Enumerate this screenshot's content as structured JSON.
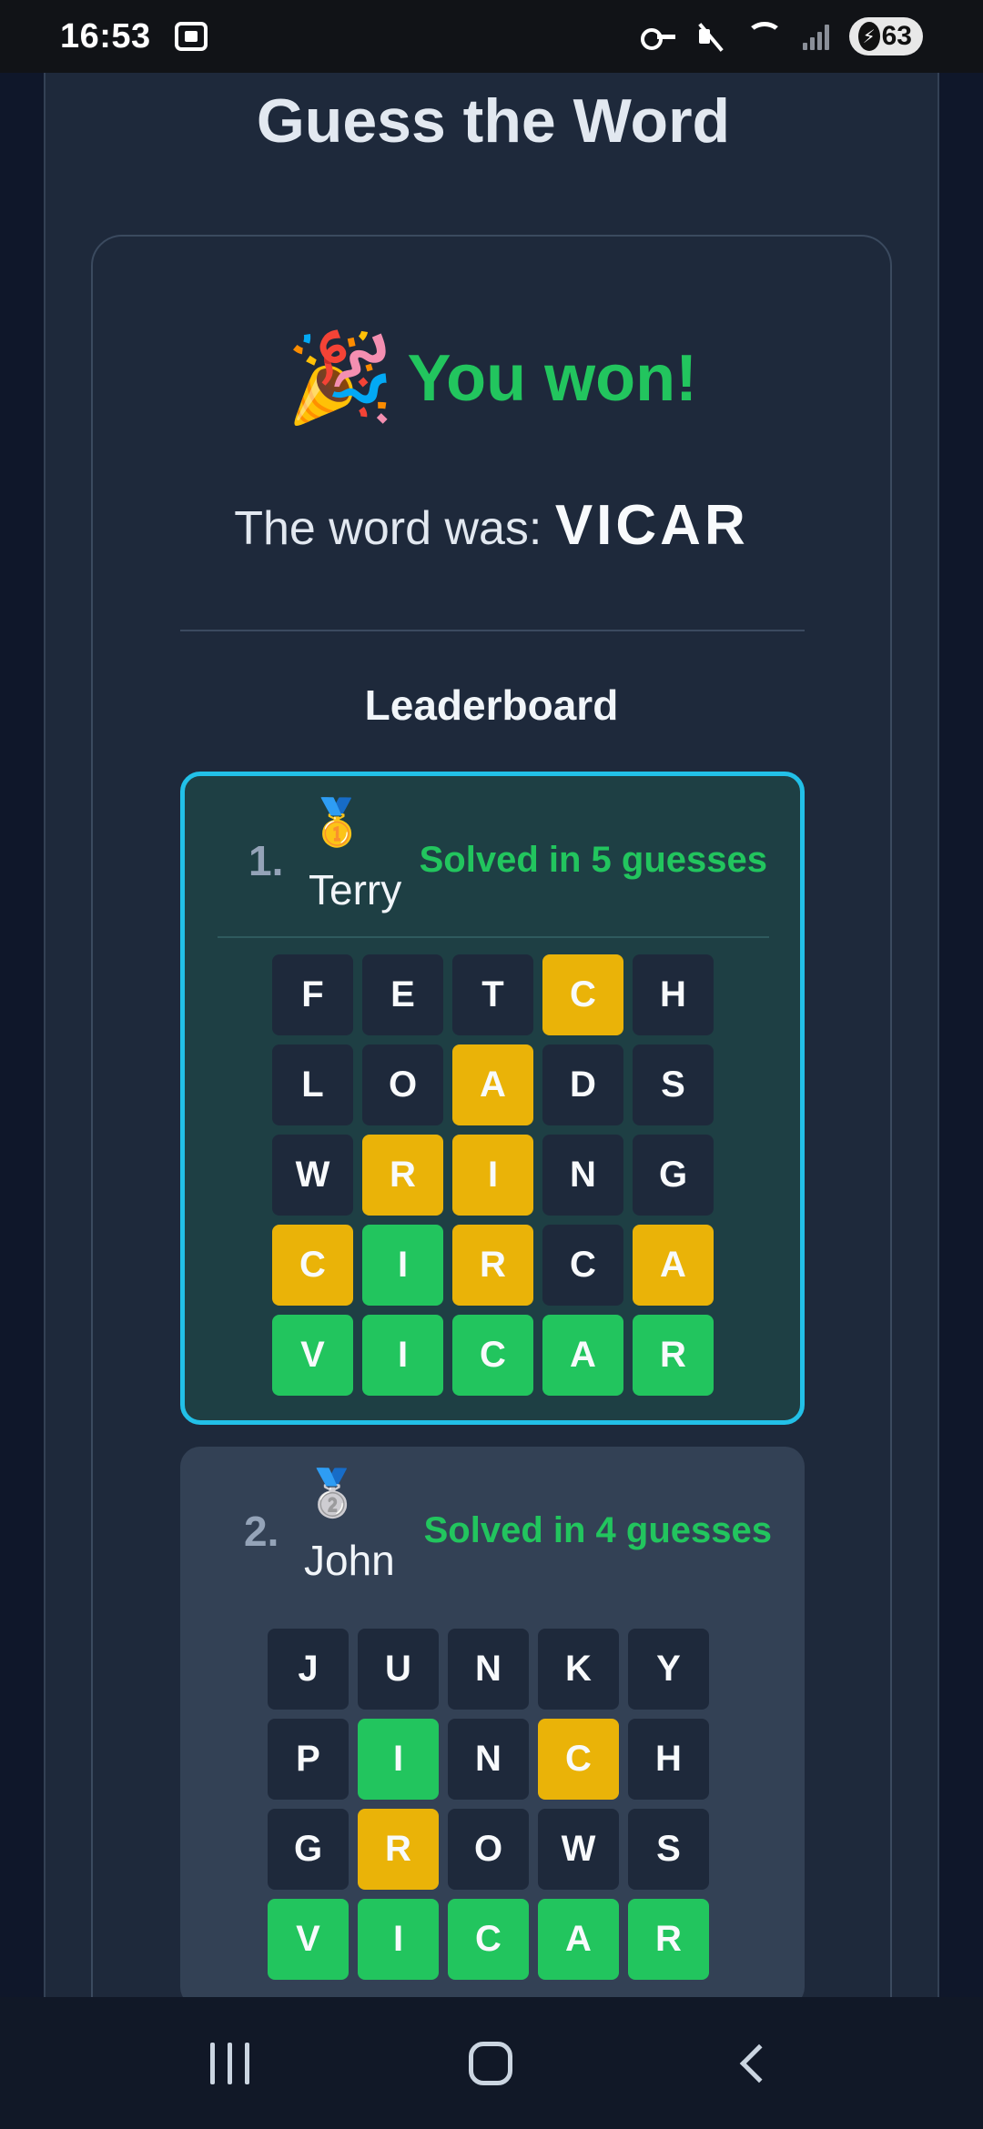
{
  "status_bar": {
    "time": "16:53",
    "battery": "63",
    "icons": [
      "screenshot-icon",
      "vpn-key-icon",
      "mute-icon",
      "wifi-icon",
      "signal-icon",
      "battery-charging-icon"
    ]
  },
  "app": {
    "title": "Guess the Word"
  },
  "result": {
    "emoji": "🎉",
    "headline": "You won!",
    "word_prefix": "The word was: ",
    "word": "VICAR"
  },
  "leaderboard": {
    "title": "Leaderboard",
    "entries": [
      {
        "rank": "1.",
        "medal": "🥇",
        "name": "Terry",
        "status": "Solved in 5 guesses",
        "guesses": [
          [
            [
              "F",
              "absent"
            ],
            [
              "E",
              "absent"
            ],
            [
              "T",
              "absent"
            ],
            [
              "C",
              "present"
            ],
            [
              "H",
              "absent"
            ]
          ],
          [
            [
              "L",
              "absent"
            ],
            [
              "O",
              "absent"
            ],
            [
              "A",
              "present"
            ],
            [
              "D",
              "absent"
            ],
            [
              "S",
              "absent"
            ]
          ],
          [
            [
              "W",
              "absent"
            ],
            [
              "R",
              "present"
            ],
            [
              "I",
              "present"
            ],
            [
              "N",
              "absent"
            ],
            [
              "G",
              "absent"
            ]
          ],
          [
            [
              "C",
              "present"
            ],
            [
              "I",
              "correct"
            ],
            [
              "R",
              "present"
            ],
            [
              "C",
              "absent"
            ],
            [
              "A",
              "present"
            ]
          ],
          [
            [
              "V",
              "correct"
            ],
            [
              "I",
              "correct"
            ],
            [
              "C",
              "correct"
            ],
            [
              "A",
              "correct"
            ],
            [
              "R",
              "correct"
            ]
          ]
        ]
      },
      {
        "rank": "2.",
        "medal": "🥈",
        "name": "John",
        "status": "Solved in 4 guesses",
        "guesses": [
          [
            [
              "J",
              "absent"
            ],
            [
              "U",
              "absent"
            ],
            [
              "N",
              "absent"
            ],
            [
              "K",
              "absent"
            ],
            [
              "Y",
              "absent"
            ]
          ],
          [
            [
              "P",
              "absent"
            ],
            [
              "I",
              "correct"
            ],
            [
              "N",
              "absent"
            ],
            [
              "C",
              "present"
            ],
            [
              "H",
              "absent"
            ]
          ],
          [
            [
              "G",
              "absent"
            ],
            [
              "R",
              "present"
            ],
            [
              "O",
              "absent"
            ],
            [
              "W",
              "absent"
            ],
            [
              "S",
              "absent"
            ]
          ],
          [
            [
              "V",
              "correct"
            ],
            [
              "I",
              "correct"
            ],
            [
              "C",
              "correct"
            ],
            [
              "A",
              "correct"
            ],
            [
              "R",
              "correct"
            ]
          ]
        ]
      }
    ]
  },
  "colors": {
    "correct": "#22c55e",
    "present": "#eab308",
    "absent": "#1e293b",
    "highlight_border": "#22c0e8"
  },
  "nav_bar": {
    "icons": [
      "recent-apps-icon",
      "home-icon",
      "back-icon"
    ]
  }
}
